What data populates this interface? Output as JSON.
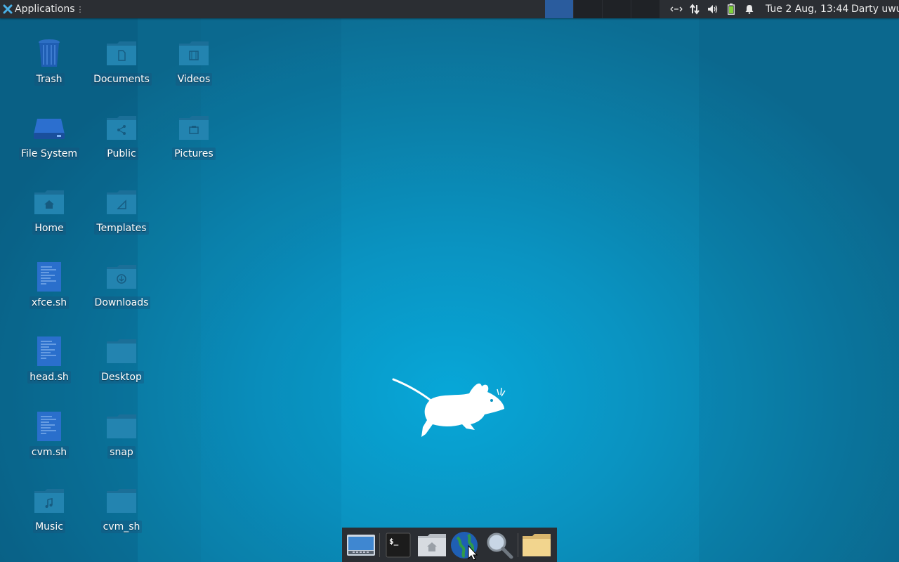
{
  "panel": {
    "app_menu_label": "Applications",
    "app_menu_dots": "⋮",
    "workspaces": [
      {
        "active": true
      },
      {
        "active": false
      },
      {
        "active": false
      },
      {
        "active": false
      }
    ],
    "tray_icons": [
      "network-activity-icon",
      "network-updown-icon",
      "volume-icon",
      "battery-icon",
      "notification-bell-icon"
    ],
    "clock": "Tue  2 Aug, 13:44",
    "user": "Darty uwu"
  },
  "desktop": {
    "icons": [
      {
        "label": "Trash",
        "icon": "trash-icon"
      },
      {
        "label": "File System",
        "icon": "drive-icon"
      },
      {
        "label": "Home",
        "icon": "home-folder-icon"
      },
      {
        "label": "xfce.sh",
        "icon": "script-file-icon"
      },
      {
        "label": "head.sh",
        "icon": "script-file-icon"
      },
      {
        "label": "cvm.sh",
        "icon": "script-file-icon"
      },
      {
        "label": "Music",
        "icon": "music-folder-icon"
      },
      {
        "label": "Documents",
        "icon": "documents-folder-icon"
      },
      {
        "label": "Public",
        "icon": "public-folder-icon"
      },
      {
        "label": "Templates",
        "icon": "templates-folder-icon"
      },
      {
        "label": "Downloads",
        "icon": "downloads-folder-icon"
      },
      {
        "label": "Desktop",
        "icon": "folder-icon"
      },
      {
        "label": "snap",
        "icon": "folder-icon"
      },
      {
        "label": "cvm_sh",
        "icon": "folder-icon"
      },
      {
        "label": "Videos",
        "icon": "videos-folder-icon"
      },
      {
        "label": "Pictures",
        "icon": "pictures-folder-icon"
      }
    ]
  },
  "dock": {
    "items": [
      {
        "icon": "show-desktop-icon"
      },
      {
        "icon": "terminal-icon",
        "text": "$_"
      },
      {
        "icon": "home-folder-icon"
      },
      {
        "icon": "web-browser-globe-icon"
      },
      {
        "icon": "search-magnifier-icon"
      },
      {
        "icon": "file-manager-folder-icon"
      }
    ]
  },
  "colors": {
    "panel_bg": "#2b2e33",
    "workspace_active": "#2a5c9e",
    "desktop_accent": "#07a7d8",
    "folder": "#1f7aa2"
  }
}
